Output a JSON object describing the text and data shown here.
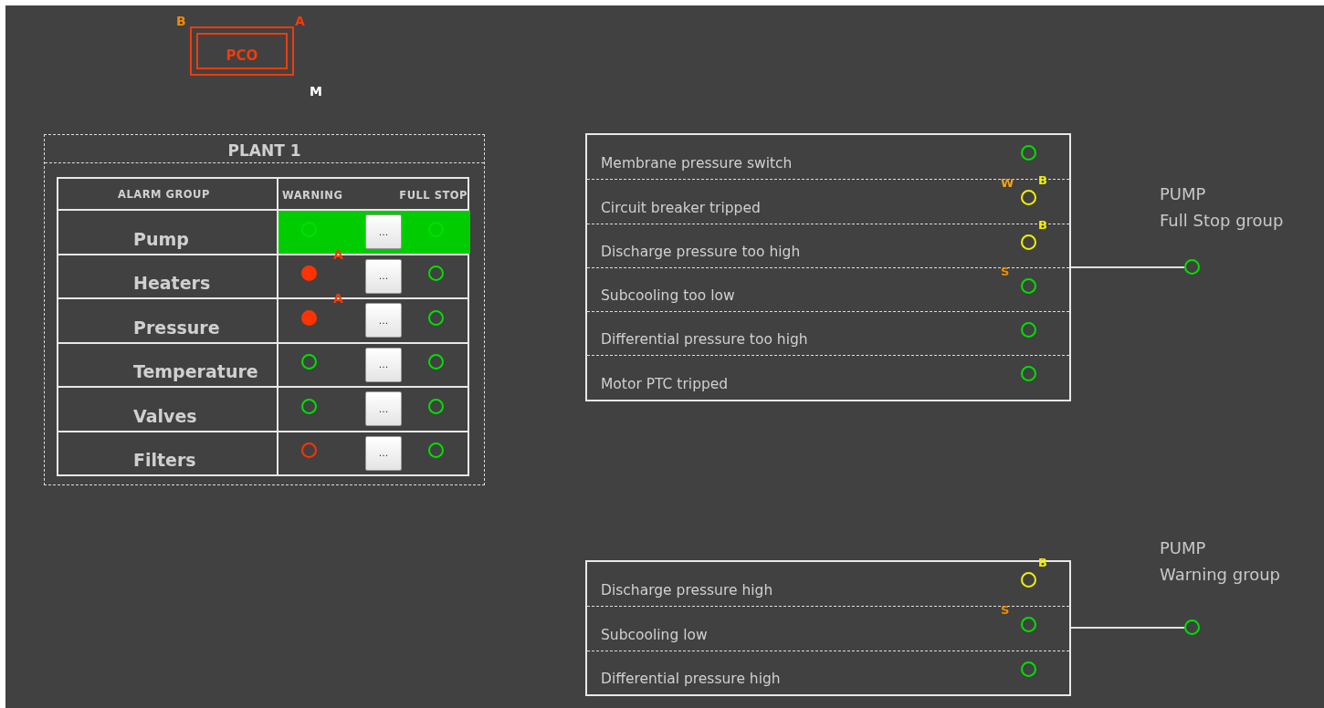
{
  "pco": {
    "label": "PCO",
    "markers": [
      {
        "text": "B",
        "color": "#f08c00",
        "kind": "topleft"
      },
      {
        "text": "A",
        "color": "#f03c0a",
        "kind": "topright"
      },
      {
        "text": "M",
        "color": "#ffffff",
        "kind": "bottomright"
      }
    ]
  },
  "plant": {
    "title": "PLANT 1",
    "columns": [
      "ALARM GROUP",
      "WARNING",
      "FULL STOP"
    ],
    "rows": [
      {
        "name": "Pump",
        "selected": true,
        "warning": {
          "color": "#00e000",
          "filled": false
        },
        "button": "...",
        "full_stop": {
          "color": "#00e000",
          "filled": false
        }
      },
      {
        "name": "Heaters",
        "selected": false,
        "flag": {
          "text": "A",
          "color": "#f03c0a"
        },
        "warning": {
          "color": "#ff3300",
          "filled": true
        },
        "button": "...",
        "full_stop": {
          "color": "#00e000",
          "filled": false
        }
      },
      {
        "name": "Pressure",
        "selected": false,
        "flag": {
          "text": "A",
          "color": "#f03c0a"
        },
        "warning": {
          "color": "#ff3300",
          "filled": true
        },
        "button": "...",
        "full_stop": {
          "color": "#00e000",
          "filled": false
        }
      },
      {
        "name": "Temperature",
        "selected": false,
        "warning": {
          "color": "#00e000",
          "filled": false
        },
        "button": "...",
        "full_stop": {
          "color": "#00e000",
          "filled": false
        }
      },
      {
        "name": "Valves",
        "selected": false,
        "warning": {
          "color": "#00e000",
          "filled": false
        },
        "button": "...",
        "full_stop": {
          "color": "#00e000",
          "filled": false
        }
      },
      {
        "name": "Filters",
        "selected": false,
        "warning": {
          "color": "#ff3300",
          "filled": false
        },
        "button": "...",
        "full_stop": {
          "color": "#00e000",
          "filled": false
        }
      }
    ]
  },
  "full_stop_group": {
    "title": [
      "PUMP",
      "Full Stop group"
    ],
    "items": [
      {
        "label": "Membrane pressure switch",
        "light": {
          "color": "#00e000"
        }
      },
      {
        "label": "Circuit breaker tripped",
        "light": {
          "color": "#f0f000"
        },
        "marks": [
          {
            "text": "W",
            "color": "#f0a020",
            "kind": "left"
          },
          {
            "text": "B",
            "color": "#f0f000",
            "kind": "right"
          }
        ]
      },
      {
        "label": "Discharge pressure too high",
        "light": {
          "color": "#f0f000"
        },
        "marks": [
          {
            "text": "B",
            "color": "#f0f000",
            "kind": "right"
          }
        ]
      },
      {
        "label": "Subcooling too low",
        "light": {
          "color": "#00e000"
        },
        "marks": [
          {
            "text": "S",
            "color": "#f08c00",
            "kind": "left"
          }
        ]
      },
      {
        "label": "Differential pressure too high",
        "light": {
          "color": "#00e000"
        }
      },
      {
        "label": "Motor PTC tripped",
        "light": {
          "color": "#00e000"
        }
      }
    ],
    "output": {
      "color": "#00e000"
    }
  },
  "warning_group": {
    "title": [
      "PUMP",
      "Warning group"
    ],
    "items": [
      {
        "label": "Discharge pressure high",
        "light": {
          "color": "#f0f000"
        },
        "marks": [
          {
            "text": "B",
            "color": "#f0f000",
            "kind": "right"
          }
        ]
      },
      {
        "label": "Subcooling low",
        "light": {
          "color": "#00e000"
        },
        "marks": [
          {
            "text": "S",
            "color": "#f08c00",
            "kind": "left"
          }
        ]
      },
      {
        "label": "Differential pressure high",
        "light": {
          "color": "#00e000"
        }
      }
    ],
    "output": {
      "color": "#00e000"
    }
  }
}
